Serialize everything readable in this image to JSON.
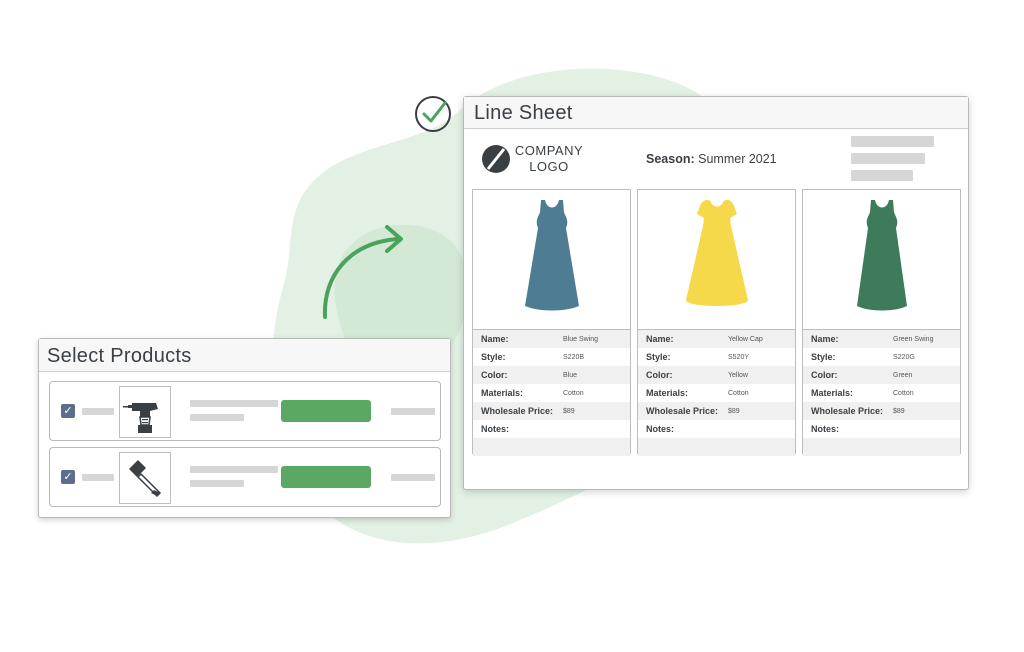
{
  "select_panel": {
    "title": "Select Products",
    "rows": [
      {
        "checked_glyph": "✓",
        "icon": "drill-icon"
      },
      {
        "checked_glyph": "✓",
        "icon": "hammer-icon"
      }
    ]
  },
  "line_sheet": {
    "title": "Line Sheet",
    "logo": {
      "line1": "COMPANY",
      "line2": "LOGO"
    },
    "season_label": "Season:",
    "season_value": "Summer 2021",
    "products": [
      {
        "color_hex": "#4e7d93",
        "fields": [
          {
            "key": "Name:",
            "value": "Blue Swing"
          },
          {
            "key": "Style:",
            "value": "S220B"
          },
          {
            "key": "Color:",
            "value": "Blue"
          },
          {
            "key": "Materials:",
            "value": "Cotton"
          },
          {
            "key": "Wholesale Price:",
            "value": "$89"
          },
          {
            "key": "Notes:",
            "value": ""
          }
        ]
      },
      {
        "color_hex": "#f6d94b",
        "fields": [
          {
            "key": "Name:",
            "value": "Yellow Cap"
          },
          {
            "key": "Style:",
            "value": "S520Y"
          },
          {
            "key": "Color:",
            "value": "Yellow"
          },
          {
            "key": "Materials:",
            "value": "Cotton"
          },
          {
            "key": "Wholesale Price:",
            "value": "$89"
          },
          {
            "key": "Notes:",
            "value": ""
          }
        ]
      },
      {
        "color_hex": "#3d7b5b",
        "fields": [
          {
            "key": "Name:",
            "value": "Green Swing"
          },
          {
            "key": "Style:",
            "value": "S220G"
          },
          {
            "key": "Color:",
            "value": "Green"
          },
          {
            "key": "Materials:",
            "value": "Cotton"
          },
          {
            "key": "Wholesale Price:",
            "value": "$89"
          },
          {
            "key": "Notes:",
            "value": ""
          }
        ]
      }
    ]
  },
  "colors": {
    "accent_green": "#5aa862",
    "blob_green": "#d9ecdc",
    "checkbox": "#5d6e8c"
  }
}
